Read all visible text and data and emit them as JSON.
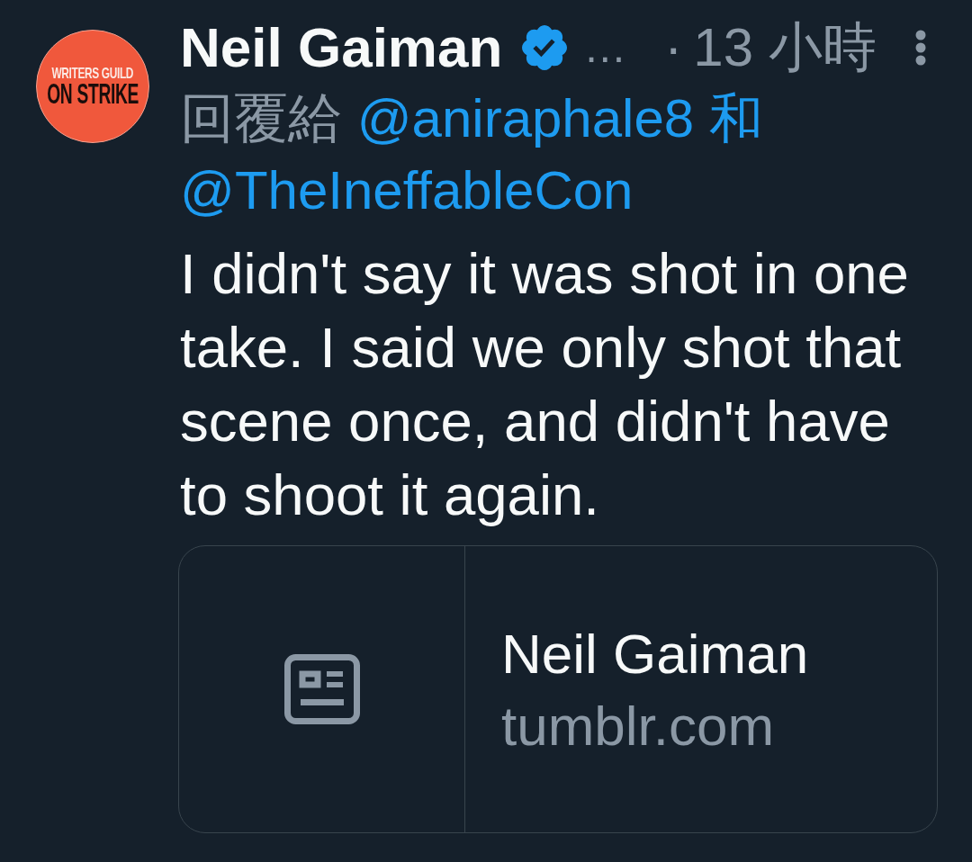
{
  "author": {
    "avatar": {
      "lines": [
        {
          "text": "WRITERS GUILD",
          "kind": "caption"
        },
        {
          "text": "ON STRIKE",
          "kind": "headline"
        }
      ]
    },
    "name": "Neil Gaiman",
    "verified": true,
    "handle": "…",
    "separator": "·",
    "time": "13 小時"
  },
  "reply": {
    "label": "回覆給",
    "mentions": [
      "@aniraphale8",
      "@TheIneffableCon"
    ],
    "joiner": "和"
  },
  "text": "I didn't say it was shot in one take. I said we only shot that scene once, and didn't have to shoot it again.",
  "card": {
    "title": "Neil Gaiman",
    "domain": "tumblr.com"
  }
}
